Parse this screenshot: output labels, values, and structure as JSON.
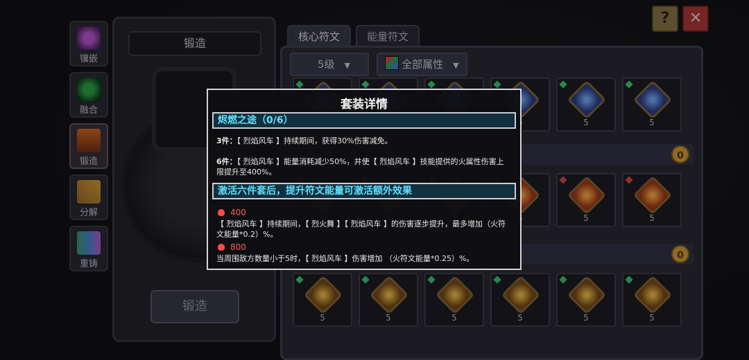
{
  "sidebar": {
    "items": [
      {
        "label": "镶嵌",
        "icon": "potion-icon"
      },
      {
        "label": "融合",
        "icon": "fusion-icon"
      },
      {
        "label": "锻造",
        "icon": "anvil-icon"
      },
      {
        "label": "分解",
        "icon": "crossed-swords-icon"
      },
      {
        "label": "重铸",
        "icon": "crystals-icon"
      }
    ]
  },
  "forge": {
    "title": "锻造",
    "button_label": "锻造"
  },
  "tabs": [
    {
      "label": "核心符文"
    },
    {
      "label": "能量符文"
    }
  ],
  "filters": {
    "level": "5级",
    "attribute": "全部属性"
  },
  "grid": {
    "row_level_label": "5",
    "section_coin": "0"
  },
  "corner": {
    "help": "?",
    "close": "✕"
  },
  "popup": {
    "title": "套装详情",
    "set_name": "烬燃之途（0/6）",
    "bonus3": {
      "count": "3件：",
      "text": "【 烈焰风车 】持续期间，获得30%伤害减免。"
    },
    "bonus6": {
      "count": "6件：",
      "text": "【 烈焰风车 】能量消耗减少50%，并使【 烈焰风车 】技能提供的火属性伤害上限提升至400%。"
    },
    "extra_title": "激活六件套后，提升符文能量可激活额外效果",
    "extra": [
      {
        "threshold": "400",
        "text": "【 烈焰风车 】持续期间，【 烈火舞 】【 烈焰风车 】的伤害逐步提升，最多增加（火符文能量*0.2）%。"
      },
      {
        "threshold": "800",
        "text": "当周围敌方数量小于5时，【 烈焰风车 】伤害增加 （火符文能量*0.25）%。"
      }
    ]
  },
  "colors": {
    "set_name_cyan": "#5fe1ff",
    "threshold_red": "#ff5a5a"
  }
}
